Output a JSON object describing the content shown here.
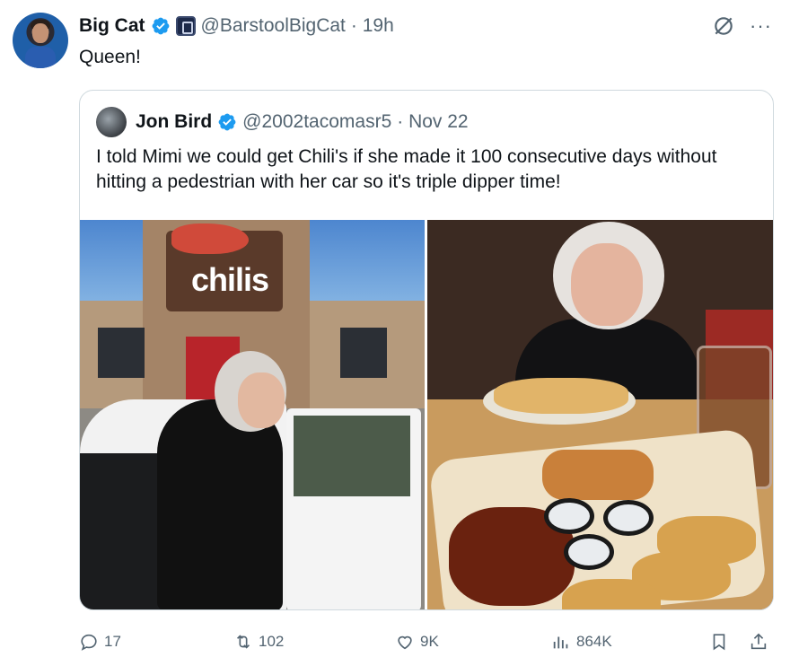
{
  "author": {
    "name": "Big Cat",
    "handle": "@BarstoolBigCat",
    "time": "· 19h"
  },
  "tweet_text": "Queen!",
  "quoted": {
    "name": "Jon Bird",
    "handle": "@2002tacomasr5",
    "time": "· Nov 22",
    "text": "I told Mimi we could get Chili's if she made it 100 consecutive days without hitting a pedestrian with her car so it's triple dipper time!",
    "sign_text": "chilis"
  },
  "actions": {
    "replies": "17",
    "reposts": "102",
    "likes": "9K",
    "views": "864K"
  },
  "icons": [
    "grok-icon",
    "more-icon",
    "verified-icon",
    "affiliate-badge-icon",
    "reply-icon",
    "repost-icon",
    "like-icon",
    "views-icon",
    "bookmark-icon",
    "share-icon"
  ],
  "colors": {
    "text": "#0f1419",
    "secondary": "#536471",
    "verified": "#1d9bf0",
    "border": "#cfd9de"
  }
}
